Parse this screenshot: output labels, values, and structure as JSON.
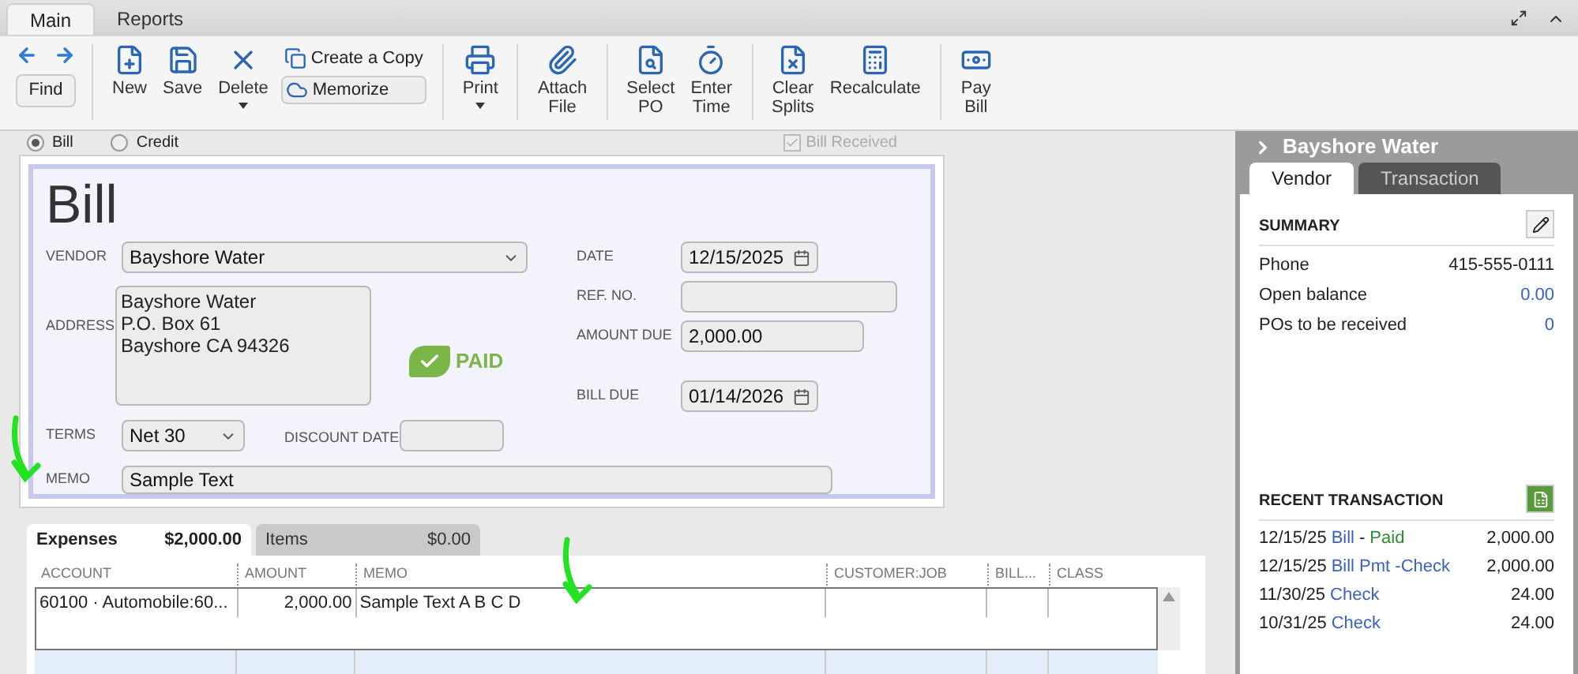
{
  "tabs": [
    {
      "label": "Main",
      "selected": true
    },
    {
      "label": "Reports",
      "selected": false
    }
  ],
  "toolbar": {
    "find": "Find",
    "groups": [
      [
        {
          "kind": "large",
          "label": "New"
        },
        {
          "kind": "large",
          "label": "Save"
        },
        {
          "kind": "large",
          "label": "Delete",
          "dropdown": true
        },
        {
          "kind": "small",
          "labels": [
            "Create a Copy",
            "Memorize"
          ]
        }
      ],
      [
        {
          "kind": "large",
          "label": "Print",
          "dropdown": true
        }
      ],
      [
        {
          "kind": "large",
          "label": "Attach File"
        }
      ],
      [
        {
          "kind": "large",
          "label": "Select PO"
        },
        {
          "kind": "large",
          "label": "Enter Time"
        }
      ],
      [
        {
          "kind": "large",
          "label": "Clear Splits"
        },
        {
          "kind": "large",
          "label": "Recalculate"
        }
      ],
      [
        {
          "kind": "large",
          "label": "Pay Bill"
        }
      ]
    ]
  },
  "bill_types": [
    {
      "label": "Bill",
      "selected": true
    },
    {
      "label": "Credit",
      "selected": false
    }
  ],
  "bill_received": {
    "label": "Bill Received",
    "checked": true,
    "disabled": true
  },
  "bill": {
    "title": "Bill",
    "status": "PAID",
    "vendor": {
      "label": "VENDOR",
      "value": "Bayshore Water"
    },
    "address": {
      "label": "ADDRESS",
      "lines": [
        "Bayshore Water",
        "P.O. Box 61",
        "Bayshore CA 94326"
      ]
    },
    "date": {
      "label": "DATE",
      "value": "12/15/2025"
    },
    "ref_no": {
      "label": "REF. NO."
    },
    "amount_due": {
      "label": "AMOUNT DUE",
      "value": "2,000.00"
    },
    "bill_due": {
      "label": "BILL DUE",
      "value": "01/14/2026"
    },
    "terms": {
      "label": "TERMS",
      "value": "Net 30"
    },
    "discount_date": {
      "label": "DISCOUNT DATE"
    },
    "memo": {
      "label": "MEMO",
      "value": "Sample Text"
    }
  },
  "detail_tabs": [
    {
      "label": "Expenses",
      "amount": "$2,000.00",
      "selected": true
    },
    {
      "label": "Items",
      "amount": "$0.00",
      "selected": false
    }
  ],
  "table": {
    "columns": [
      "ACCOUNT",
      "AMOUNT",
      "MEMO",
      "CUSTOMER:JOB",
      "BILL...",
      "CLASS"
    ],
    "rows": [
      {
        "account": "60100 · Automobile:60...",
        "amount": "2,000.00",
        "memo": "Sample Text A B C D"
      }
    ]
  },
  "side_panel": {
    "title": "Bayshore Water",
    "tabs": [
      {
        "label": "Vendor",
        "selected": true
      },
      {
        "label": "Transaction",
        "selected": false
      }
    ],
    "summary": {
      "heading": "SUMMARY",
      "rows": [
        {
          "label": "Phone",
          "value": "415-555-0111",
          "link": false
        },
        {
          "label": "Open balance",
          "value": "0.00",
          "link": true
        },
        {
          "label": "POs to be received",
          "value": "0",
          "link": true
        }
      ]
    },
    "recent": {
      "heading": "RECENT TRANSACTION",
      "rows": [
        {
          "date": "12/15/25",
          "type": "Bill",
          "separator": "-",
          "status": "Paid",
          "amount": "2,000.00"
        },
        {
          "date": "12/15/25",
          "type": "Bill Pmt -Check",
          "amount": "2,000.00"
        },
        {
          "date": "11/30/25",
          "type": "Check",
          "amount": "24.00"
        },
        {
          "date": "10/31/25",
          "type": "Check",
          "amount": "24.00"
        }
      ]
    }
  }
}
